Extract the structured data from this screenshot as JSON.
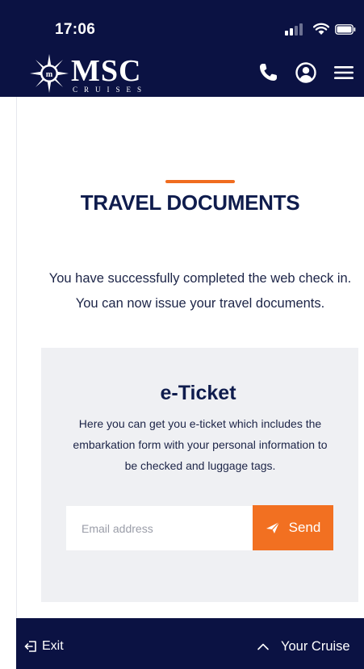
{
  "status_bar": {
    "time": "17:06",
    "icons": [
      "signal-icon",
      "wifi-icon",
      "battery-icon"
    ]
  },
  "header": {
    "logo_text": "MSC",
    "logo_subtext": "CRUISES",
    "actions": [
      "phone-icon",
      "user-icon",
      "menu-icon"
    ],
    "colors": {
      "background": "#0b1243",
      "foreground": "#ffffff"
    }
  },
  "page": {
    "title": "TRAVEL DOCUMENTS",
    "intro": "You have successfully completed the web check in. You can now issue your travel documents.",
    "accent_color": "#f06c1f"
  },
  "ticket": {
    "title": "e-Ticket",
    "description": "Here you can get you e-ticket which includes the embarkation form with your personal information to be checked and luggage tags.",
    "email_placeholder": "Email address",
    "email_value": "",
    "send_label": "Send",
    "send_icon": "paper-plane-icon",
    "button_color": "#f27021"
  },
  "footer": {
    "exit_label": "Exit",
    "exit_icon": "exit-icon",
    "cruise_label": "Your Cruise",
    "cruise_icon": "chevron-up-icon"
  }
}
